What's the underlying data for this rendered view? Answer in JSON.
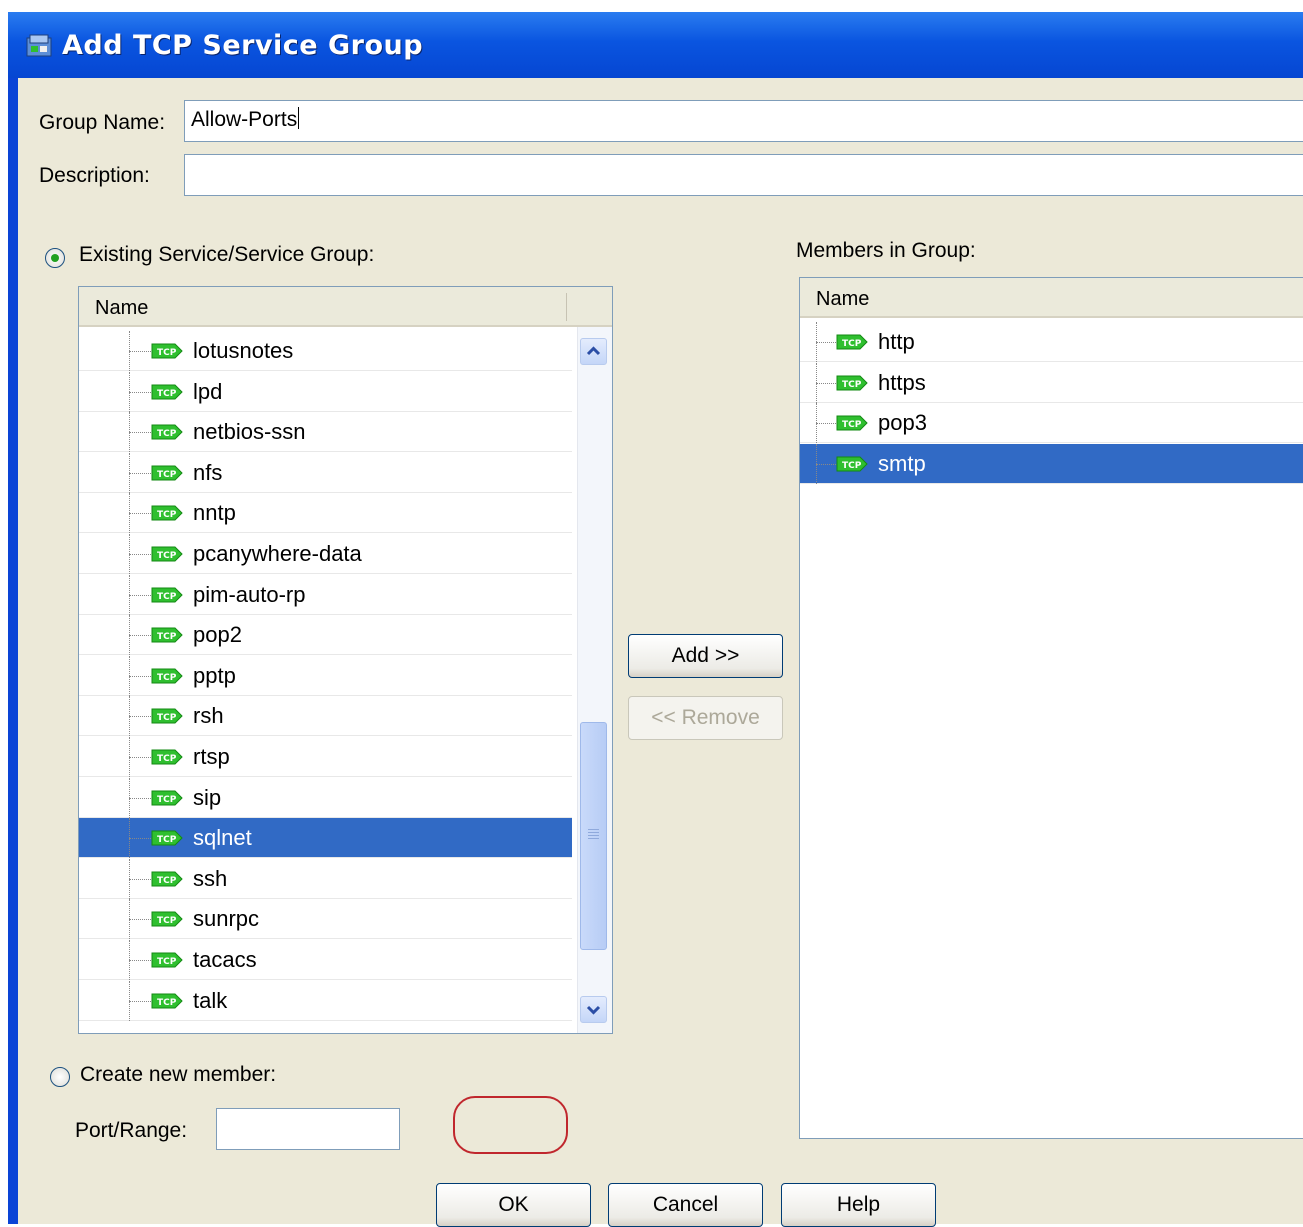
{
  "window": {
    "title": "Add TCP Service Group"
  },
  "form": {
    "group_name_label": "Group Name:",
    "group_name_value": "Allow-Ports",
    "description_label": "Description:",
    "description_value": ""
  },
  "existing": {
    "radio_label": "Existing Service/Service Group:",
    "selected": true,
    "column_header": "Name",
    "items": [
      "lotusnotes",
      "lpd",
      "netbios-ssn",
      "nfs",
      "nntp",
      "pcanywhere-data",
      "pim-auto-rp",
      "pop2",
      "pptp",
      "rsh",
      "rtsp",
      "sip",
      "sqlnet",
      "ssh",
      "sunrpc",
      "tacacs",
      "talk"
    ],
    "selected_item": "sqlnet"
  },
  "members": {
    "label": "Members in Group:",
    "column_header": "Name",
    "items": [
      "http",
      "https",
      "pop3",
      "smtp"
    ],
    "selected_item": "smtp"
  },
  "create_new": {
    "radio_label": "Create new member:",
    "selected": false,
    "port_range_label": "Port/Range:",
    "port_range_value": ""
  },
  "buttons": {
    "add": "Add >>",
    "remove": "<< Remove",
    "ok": "OK",
    "cancel": "Cancel",
    "help": "Help"
  },
  "icons": {
    "item_icon": "tcp-icon",
    "title_icon": "service-group-icon"
  },
  "colors": {
    "selection": "#316ac5",
    "titlebar": "#0a55e0",
    "ok_highlight": "#c0272d",
    "tcp_badge": "#2fbf2f"
  }
}
